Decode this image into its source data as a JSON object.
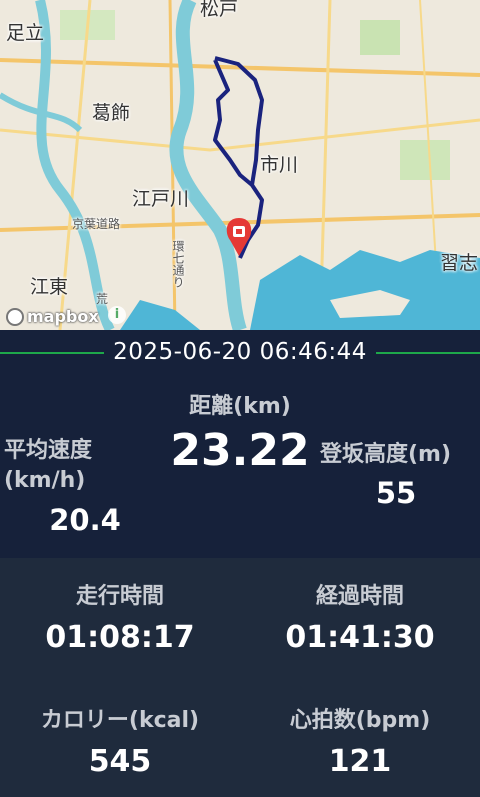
{
  "map": {
    "labels": {
      "adachi": "足立",
      "matsudo": "松戸",
      "katsushika": "葛飾",
      "ichikawa": "市川",
      "edogawa": "江戸川",
      "keiyo": "京葉道路",
      "kanshichi": "環七通り",
      "koto": "江東",
      "narashino": "習志",
      "ara": "荒"
    },
    "attribution": "mapbox",
    "info_glyph": "i",
    "colors": {
      "route": "#1a237e",
      "pin": "#e53935",
      "water": "#7fcbd8",
      "sea": "#4fb6d6"
    }
  },
  "date": "2025-06-20 06:46:44",
  "stats": {
    "distance": {
      "label": "距離(km)",
      "value": "23.22"
    },
    "avg_speed": {
      "label": "平均速度(km/h)",
      "value": "20.4"
    },
    "climb": {
      "label": "登坂高度(m)",
      "value": "55"
    },
    "moving_time": {
      "label": "走行時間",
      "value": "01:08:17"
    },
    "elapsed_time": {
      "label": "経過時間",
      "value": "01:41:30"
    },
    "calories": {
      "label": "カロリー(kcal)",
      "value": "545"
    },
    "heart_rate": {
      "label": "心拍数(bpm)",
      "value": "121"
    }
  },
  "accent": "#1ea84a"
}
